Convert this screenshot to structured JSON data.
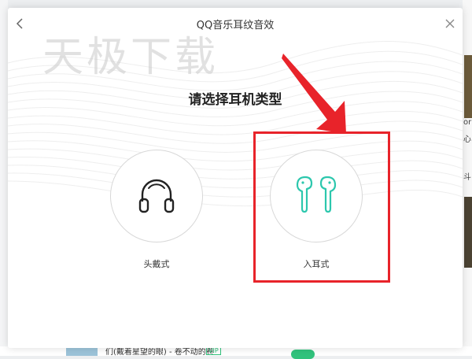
{
  "dialog": {
    "title": "QQ音乐耳纹音效",
    "watermark": "天极下载",
    "heading": "请选择耳机类型",
    "options": [
      {
        "label": "头戴式",
        "icon": "headphones-icon"
      },
      {
        "label": "入耳式",
        "icon": "earbuds-icon"
      }
    ]
  },
  "background": {
    "right_chars": [
      "or",
      "心",
      "斗"
    ],
    "bottom_text": "们(戴着星望的眼) - 卷不动的卷",
    "bottom_vip": "VIP"
  },
  "colors": {
    "accent_teal": "#2cc7ad",
    "highlight_red": "#e8232a",
    "qq_green": "#31c27c"
  }
}
